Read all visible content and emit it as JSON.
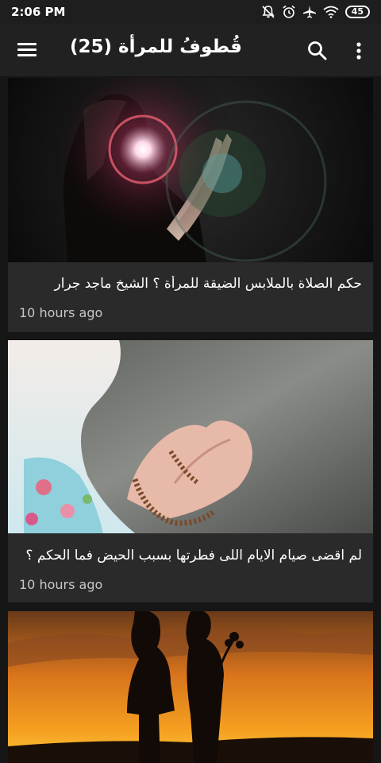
{
  "status_bar": {
    "time": "2:06 PM",
    "battery": "45",
    "icons": [
      "notifications-off-icon",
      "alarm-icon",
      "airplane-icon",
      "wifi-icon",
      "battery-icon"
    ]
  },
  "app_bar": {
    "title": "قُطوفُ للمرأة (25)",
    "icons": [
      "menu-icon",
      "search-icon",
      "more-vert-icon"
    ]
  },
  "feed": {
    "items": [
      {
        "title": "حكم الصلاة بالملابس الضيقة للمرأة ؟  الشيخ ماجد جرار",
        "time": "10 hours ago",
        "image": "woman-praying-silhouette-with-light"
      },
      {
        "title": "لم اقضى صيام الايام اللى فطرتها بسبب الحيض فما الحكم ؟",
        "time": "10 hours ago",
        "image": "hands-raised-in-prayer-with-beads"
      },
      {
        "title": "",
        "time": "",
        "image": "couple-silhouette-at-sunset"
      }
    ]
  },
  "colors": {
    "background": "#161616",
    "app_bar": "#212121",
    "card": "#2a2a2a",
    "time_text": "#c8c8c8"
  }
}
